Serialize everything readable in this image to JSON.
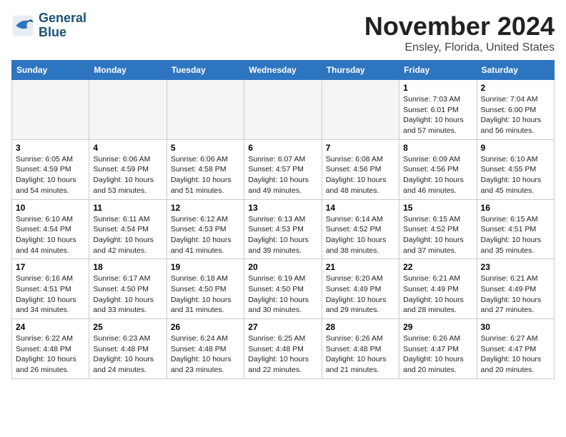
{
  "header": {
    "logo_line1": "General",
    "logo_line2": "Blue",
    "month": "November 2024",
    "location": "Ensley, Florida, United States"
  },
  "weekdays": [
    "Sunday",
    "Monday",
    "Tuesday",
    "Wednesday",
    "Thursday",
    "Friday",
    "Saturday"
  ],
  "weeks": [
    [
      {
        "day": "",
        "info": ""
      },
      {
        "day": "",
        "info": ""
      },
      {
        "day": "",
        "info": ""
      },
      {
        "day": "",
        "info": ""
      },
      {
        "day": "",
        "info": ""
      },
      {
        "day": "1",
        "info": "Sunrise: 7:03 AM\nSunset: 6:01 PM\nDaylight: 10 hours\nand 57 minutes."
      },
      {
        "day": "2",
        "info": "Sunrise: 7:04 AM\nSunset: 6:00 PM\nDaylight: 10 hours\nand 56 minutes."
      }
    ],
    [
      {
        "day": "3",
        "info": "Sunrise: 6:05 AM\nSunset: 4:59 PM\nDaylight: 10 hours\nand 54 minutes."
      },
      {
        "day": "4",
        "info": "Sunrise: 6:06 AM\nSunset: 4:59 PM\nDaylight: 10 hours\nand 53 minutes."
      },
      {
        "day": "5",
        "info": "Sunrise: 6:06 AM\nSunset: 4:58 PM\nDaylight: 10 hours\nand 51 minutes."
      },
      {
        "day": "6",
        "info": "Sunrise: 6:07 AM\nSunset: 4:57 PM\nDaylight: 10 hours\nand 49 minutes."
      },
      {
        "day": "7",
        "info": "Sunrise: 6:08 AM\nSunset: 4:56 PM\nDaylight: 10 hours\nand 48 minutes."
      },
      {
        "day": "8",
        "info": "Sunrise: 6:09 AM\nSunset: 4:56 PM\nDaylight: 10 hours\nand 46 minutes."
      },
      {
        "day": "9",
        "info": "Sunrise: 6:10 AM\nSunset: 4:55 PM\nDaylight: 10 hours\nand 45 minutes."
      }
    ],
    [
      {
        "day": "10",
        "info": "Sunrise: 6:10 AM\nSunset: 4:54 PM\nDaylight: 10 hours\nand 44 minutes."
      },
      {
        "day": "11",
        "info": "Sunrise: 6:11 AM\nSunset: 4:54 PM\nDaylight: 10 hours\nand 42 minutes."
      },
      {
        "day": "12",
        "info": "Sunrise: 6:12 AM\nSunset: 4:53 PM\nDaylight: 10 hours\nand 41 minutes."
      },
      {
        "day": "13",
        "info": "Sunrise: 6:13 AM\nSunset: 4:53 PM\nDaylight: 10 hours\nand 39 minutes."
      },
      {
        "day": "14",
        "info": "Sunrise: 6:14 AM\nSunset: 4:52 PM\nDaylight: 10 hours\nand 38 minutes."
      },
      {
        "day": "15",
        "info": "Sunrise: 6:15 AM\nSunset: 4:52 PM\nDaylight: 10 hours\nand 37 minutes."
      },
      {
        "day": "16",
        "info": "Sunrise: 6:15 AM\nSunset: 4:51 PM\nDaylight: 10 hours\nand 35 minutes."
      }
    ],
    [
      {
        "day": "17",
        "info": "Sunrise: 6:16 AM\nSunset: 4:51 PM\nDaylight: 10 hours\nand 34 minutes."
      },
      {
        "day": "18",
        "info": "Sunrise: 6:17 AM\nSunset: 4:50 PM\nDaylight: 10 hours\nand 33 minutes."
      },
      {
        "day": "19",
        "info": "Sunrise: 6:18 AM\nSunset: 4:50 PM\nDaylight: 10 hours\nand 31 minutes."
      },
      {
        "day": "20",
        "info": "Sunrise: 6:19 AM\nSunset: 4:50 PM\nDaylight: 10 hours\nand 30 minutes."
      },
      {
        "day": "21",
        "info": "Sunrise: 6:20 AM\nSunset: 4:49 PM\nDaylight: 10 hours\nand 29 minutes."
      },
      {
        "day": "22",
        "info": "Sunrise: 6:21 AM\nSunset: 4:49 PM\nDaylight: 10 hours\nand 28 minutes."
      },
      {
        "day": "23",
        "info": "Sunrise: 6:21 AM\nSunset: 4:49 PM\nDaylight: 10 hours\nand 27 minutes."
      }
    ],
    [
      {
        "day": "24",
        "info": "Sunrise: 6:22 AM\nSunset: 4:48 PM\nDaylight: 10 hours\nand 26 minutes."
      },
      {
        "day": "25",
        "info": "Sunrise: 6:23 AM\nSunset: 4:48 PM\nDaylight: 10 hours\nand 24 minutes."
      },
      {
        "day": "26",
        "info": "Sunrise: 6:24 AM\nSunset: 4:48 PM\nDaylight: 10 hours\nand 23 minutes."
      },
      {
        "day": "27",
        "info": "Sunrise: 6:25 AM\nSunset: 4:48 PM\nDaylight: 10 hours\nand 22 minutes."
      },
      {
        "day": "28",
        "info": "Sunrise: 6:26 AM\nSunset: 4:48 PM\nDaylight: 10 hours\nand 21 minutes."
      },
      {
        "day": "29",
        "info": "Sunrise: 6:26 AM\nSunset: 4:47 PM\nDaylight: 10 hours\nand 20 minutes."
      },
      {
        "day": "30",
        "info": "Sunrise: 6:27 AM\nSunset: 4:47 PM\nDaylight: 10 hours\nand 20 minutes."
      }
    ]
  ]
}
